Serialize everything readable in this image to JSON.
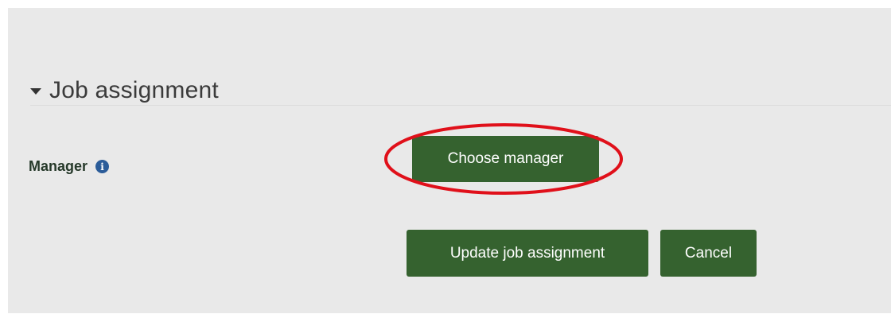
{
  "section": {
    "title": "Job assignment",
    "caret_icon": "caret-down-icon"
  },
  "manager": {
    "label": "Manager",
    "info_icon": "info-icon",
    "info_glyph": "i",
    "choose_label": "Choose manager"
  },
  "actions": {
    "update_label": "Update job assignment",
    "cancel_label": "Cancel"
  },
  "colors": {
    "panel_bg": "#e9e9e9",
    "button_green": "#35622f",
    "info_blue": "#2b5c99",
    "annotation_red": "#e0101a"
  }
}
